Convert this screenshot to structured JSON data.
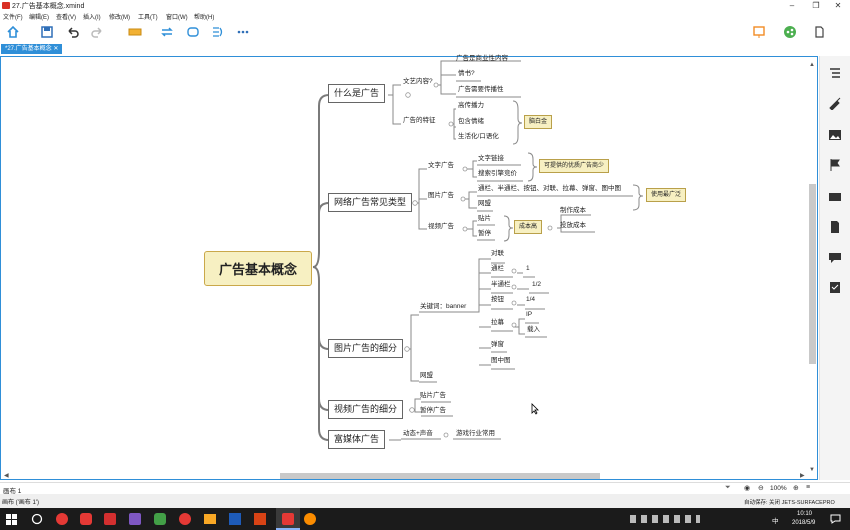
{
  "window": {
    "title": "27.广告基本概念.xmind",
    "controls": [
      "–",
      "❐",
      "✕"
    ]
  },
  "menubar": [
    "文件(F)",
    "编辑(E)",
    "查看(V)",
    "插入(I)",
    "修改(M)",
    "工具(T)",
    "窗口(W)",
    "帮助(H)"
  ],
  "tab": {
    "label": "*27.广告基本概念 ✕"
  },
  "mindmap": {
    "central": "广告基本概念",
    "branches": [
      {
        "label": "什么是广告"
      },
      {
        "label": "网络广告常见类型"
      },
      {
        "label": "图片广告的细分"
      },
      {
        "label": "视频广告的细分"
      },
      {
        "label": "富媒体广告"
      }
    ],
    "topics": {
      "wenyi": "文艺内容?",
      "wenyi_1": "广告是商业性内容",
      "wenyi_2": "情书?",
      "wenyi_3": "广告需要传播性",
      "tezheng": "广告的特征",
      "tezheng_1": "高传播力",
      "tezheng_2": "包含情绪",
      "tezheng_3": "生活化/口语化",
      "tezheng_sum": "脑白金",
      "wenzi": "文字广告",
      "wenzi_1": "文字链接",
      "wenzi_2": "搜索引擎竞价",
      "wenzi_sum": "可提供的优质广告商少",
      "tupian": "图片广告",
      "tupian_1": "通栏、半通栏、按钮、对联、拉links、弹窗、图中图",
      "tupian_2": "网盟",
      "tupian_sum": "使用最广泛",
      "shipin": "视频广告",
      "shipin_1": "贴片",
      "shipin_2": "暂停",
      "shipin_sum": "成本高",
      "shipin_c1": "制作成本",
      "shipin_c2": "投放成本",
      "banner": "关键词：banner",
      "b_duilian": "对联",
      "b_tonglan": "通栏",
      "b_tonglan_v": "1",
      "b_ban": "半通栏",
      "b_ban_v": "1/2",
      "b_anniu": "按钮",
      "b_anniu_v": "1/4",
      "b_lamu": "拉幕",
      "b_lamu_1": "IP",
      "b_lamu_2": "载入",
      "b_tanchuang": "弹窗",
      "b_tuzhongtu": "图中图",
      "wangmeng": "网盟",
      "v_tiepian": "贴片广告",
      "v_zanting": "暂停广告",
      "fumeiti": "动态+声音",
      "fumeiti_1": "游戏行业常用"
    }
  },
  "sheet": {
    "label": "画布 1"
  },
  "statusbar": {
    "left": "画布 ('画布 1')",
    "zoom": "100%",
    "right": "自动保存: 关闭  JETS-SURFACEPRO"
  },
  "taskbar": {
    "time": "10:10",
    "date": "2018/5/9",
    "ime": "中"
  },
  "colors": {
    "accent": "#2f8fd8",
    "central_bg": "#f7f0c2",
    "summary_bg": "#f7f0c2",
    "taskbar": "#1b1b1b"
  }
}
